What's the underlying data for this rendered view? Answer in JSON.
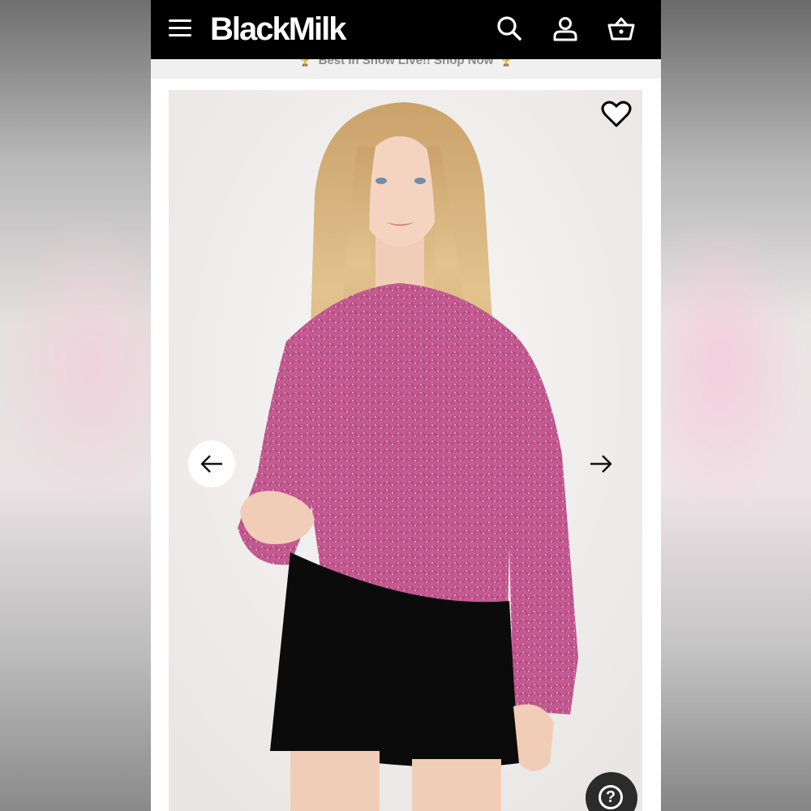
{
  "header": {
    "logo": "BlackMilk",
    "icons": [
      "menu-icon",
      "search-icon",
      "account-icon",
      "basket-icon"
    ],
    "background": "#000000"
  },
  "promo": {
    "text": "Best In Show Live!! Shop Now",
    "emoji": "🏆"
  },
  "product": {
    "image_alt": "Model wearing pink sparkly knit sweater and black skirt",
    "sweater_color": "#c2588f",
    "skirt_color": "#0b0b0b"
  },
  "controls": {
    "favorite_icon": "heart-icon",
    "prev_icon": "arrow-left-icon",
    "next_icon": "arrow-right-icon",
    "help_label": "?"
  }
}
